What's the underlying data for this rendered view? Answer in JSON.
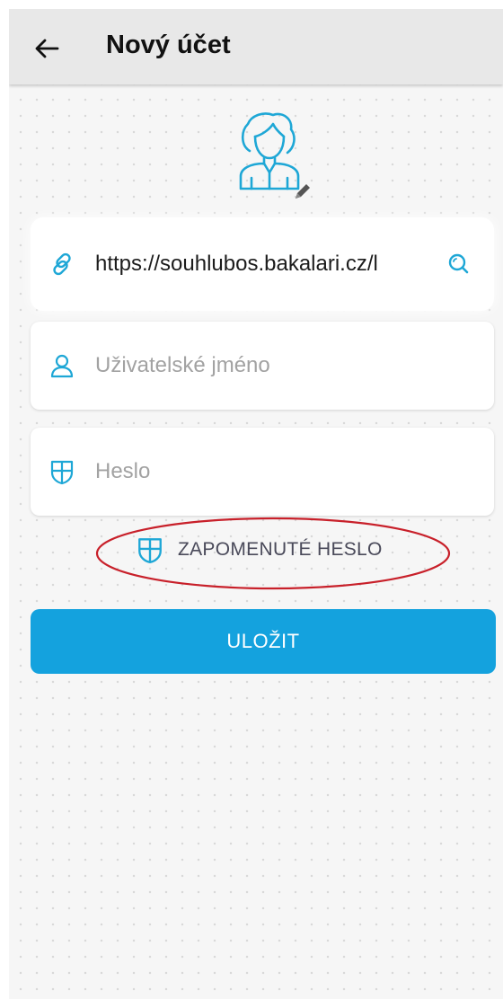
{
  "appbar": {
    "title": "Nový účet",
    "back_icon": "arrow-left-icon"
  },
  "avatar": {
    "icon": "female-avatar-icon",
    "edit_icon": "pencil-icon",
    "accent_color": "#1ea7d6"
  },
  "form": {
    "url": {
      "value": "https://souhlubos.bakalari.cz/l",
      "icon": "link-icon",
      "search_icon": "search-icon"
    },
    "username": {
      "placeholder": "Uživatelské jméno",
      "icon": "user-icon"
    },
    "password": {
      "placeholder": "Heslo",
      "icon": "shield-icon"
    }
  },
  "forgot_password": {
    "label": "ZAPOMENUTÉ HESLO",
    "icon": "shield-icon",
    "annotation_color": "#c8202a"
  },
  "save_button": {
    "label": "ULOŽIT",
    "color": "#14a2de"
  }
}
